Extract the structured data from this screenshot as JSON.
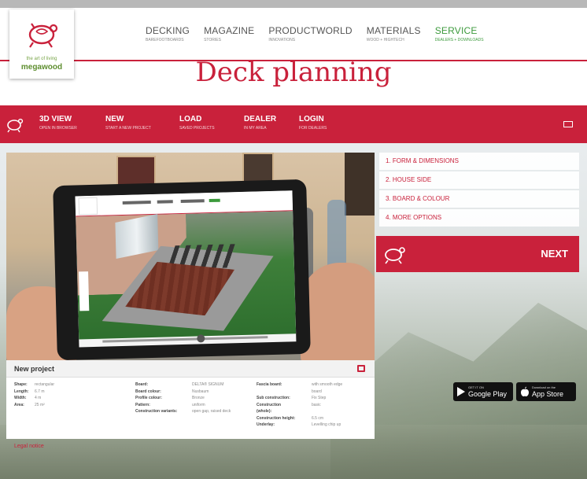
{
  "nav": {
    "items": [
      {
        "label": "DECKING",
        "sub": "BAREFOOTBOARDS"
      },
      {
        "label": "MAGAZINE",
        "sub": "STORIES"
      },
      {
        "label": "PRODUCTWORLD",
        "sub": "INNOVATIONS"
      },
      {
        "label": "MATERIALS",
        "sub": "WOOD + HIGHTECH"
      },
      {
        "label": "SERVICE",
        "sub": "DEALERS + DOWNLOADS"
      }
    ],
    "active": "SERVICE"
  },
  "logo": {
    "tagline": "the art of living",
    "brand": "megawood"
  },
  "page": {
    "title": "Deck planning"
  },
  "toolbar": {
    "items": [
      {
        "label": "3D VIEW",
        "sub": "OPEN IN BROWSER"
      },
      {
        "label": "NEW",
        "sub": "START A NEW PROJECT"
      },
      {
        "label": "LOAD",
        "sub": "SAVED PROJECTS"
      },
      {
        "label": "DEALER",
        "sub": "IN MY AREA"
      },
      {
        "label": "LOGIN",
        "sub": "FOR DEALERS"
      }
    ]
  },
  "steps": [
    "1. FORM & DIMENSIONS",
    "2. HOUSE SIDE",
    "3. BOARD & COLOUR",
    "4. MORE OPTIONS"
  ],
  "next": {
    "label": "NEXT"
  },
  "project": {
    "title": "New project",
    "col1": [
      {
        "label": "Shape:",
        "value": "rectangular"
      },
      {
        "label": "Length:",
        "value": "6.7 m"
      },
      {
        "label": "Width:",
        "value": "4 m"
      },
      {
        "label": "Area:",
        "value": "25 m²"
      }
    ],
    "col2": [
      {
        "label": "Board:",
        "value": "DELTA® SIGNUM"
      },
      {
        "label": "Board colour:",
        "value": "Nusbaum"
      },
      {
        "label": "Profile colour:",
        "value": "Bronze"
      },
      {
        "label": "Pattern:",
        "value": "uniform"
      },
      {
        "label": "Construction variants:",
        "value": "open gap, raised deck"
      }
    ],
    "col3": [
      {
        "label": "Fascia board:",
        "value": "with smooth edge"
      },
      {
        "label": "",
        "value": "board"
      },
      {
        "label": "Sub construction:",
        "value": "Fix Step"
      },
      {
        "label": "Construction",
        "value": "basic"
      },
      {
        "label": "(whole):",
        "value": ""
      },
      {
        "label": "Construction height:",
        "value": "6.5 cm"
      },
      {
        "label": "Underlay:",
        "value": "Levelling chip up"
      }
    ]
  },
  "stores": {
    "google": {
      "small": "GET IT ON",
      "big": "Google Play"
    },
    "apple": {
      "small": "Download on the",
      "big": "App Store"
    }
  },
  "legal": "Legal notice",
  "colors": {
    "brand": "#c9213b",
    "active_nav": "#3c9a3c"
  }
}
